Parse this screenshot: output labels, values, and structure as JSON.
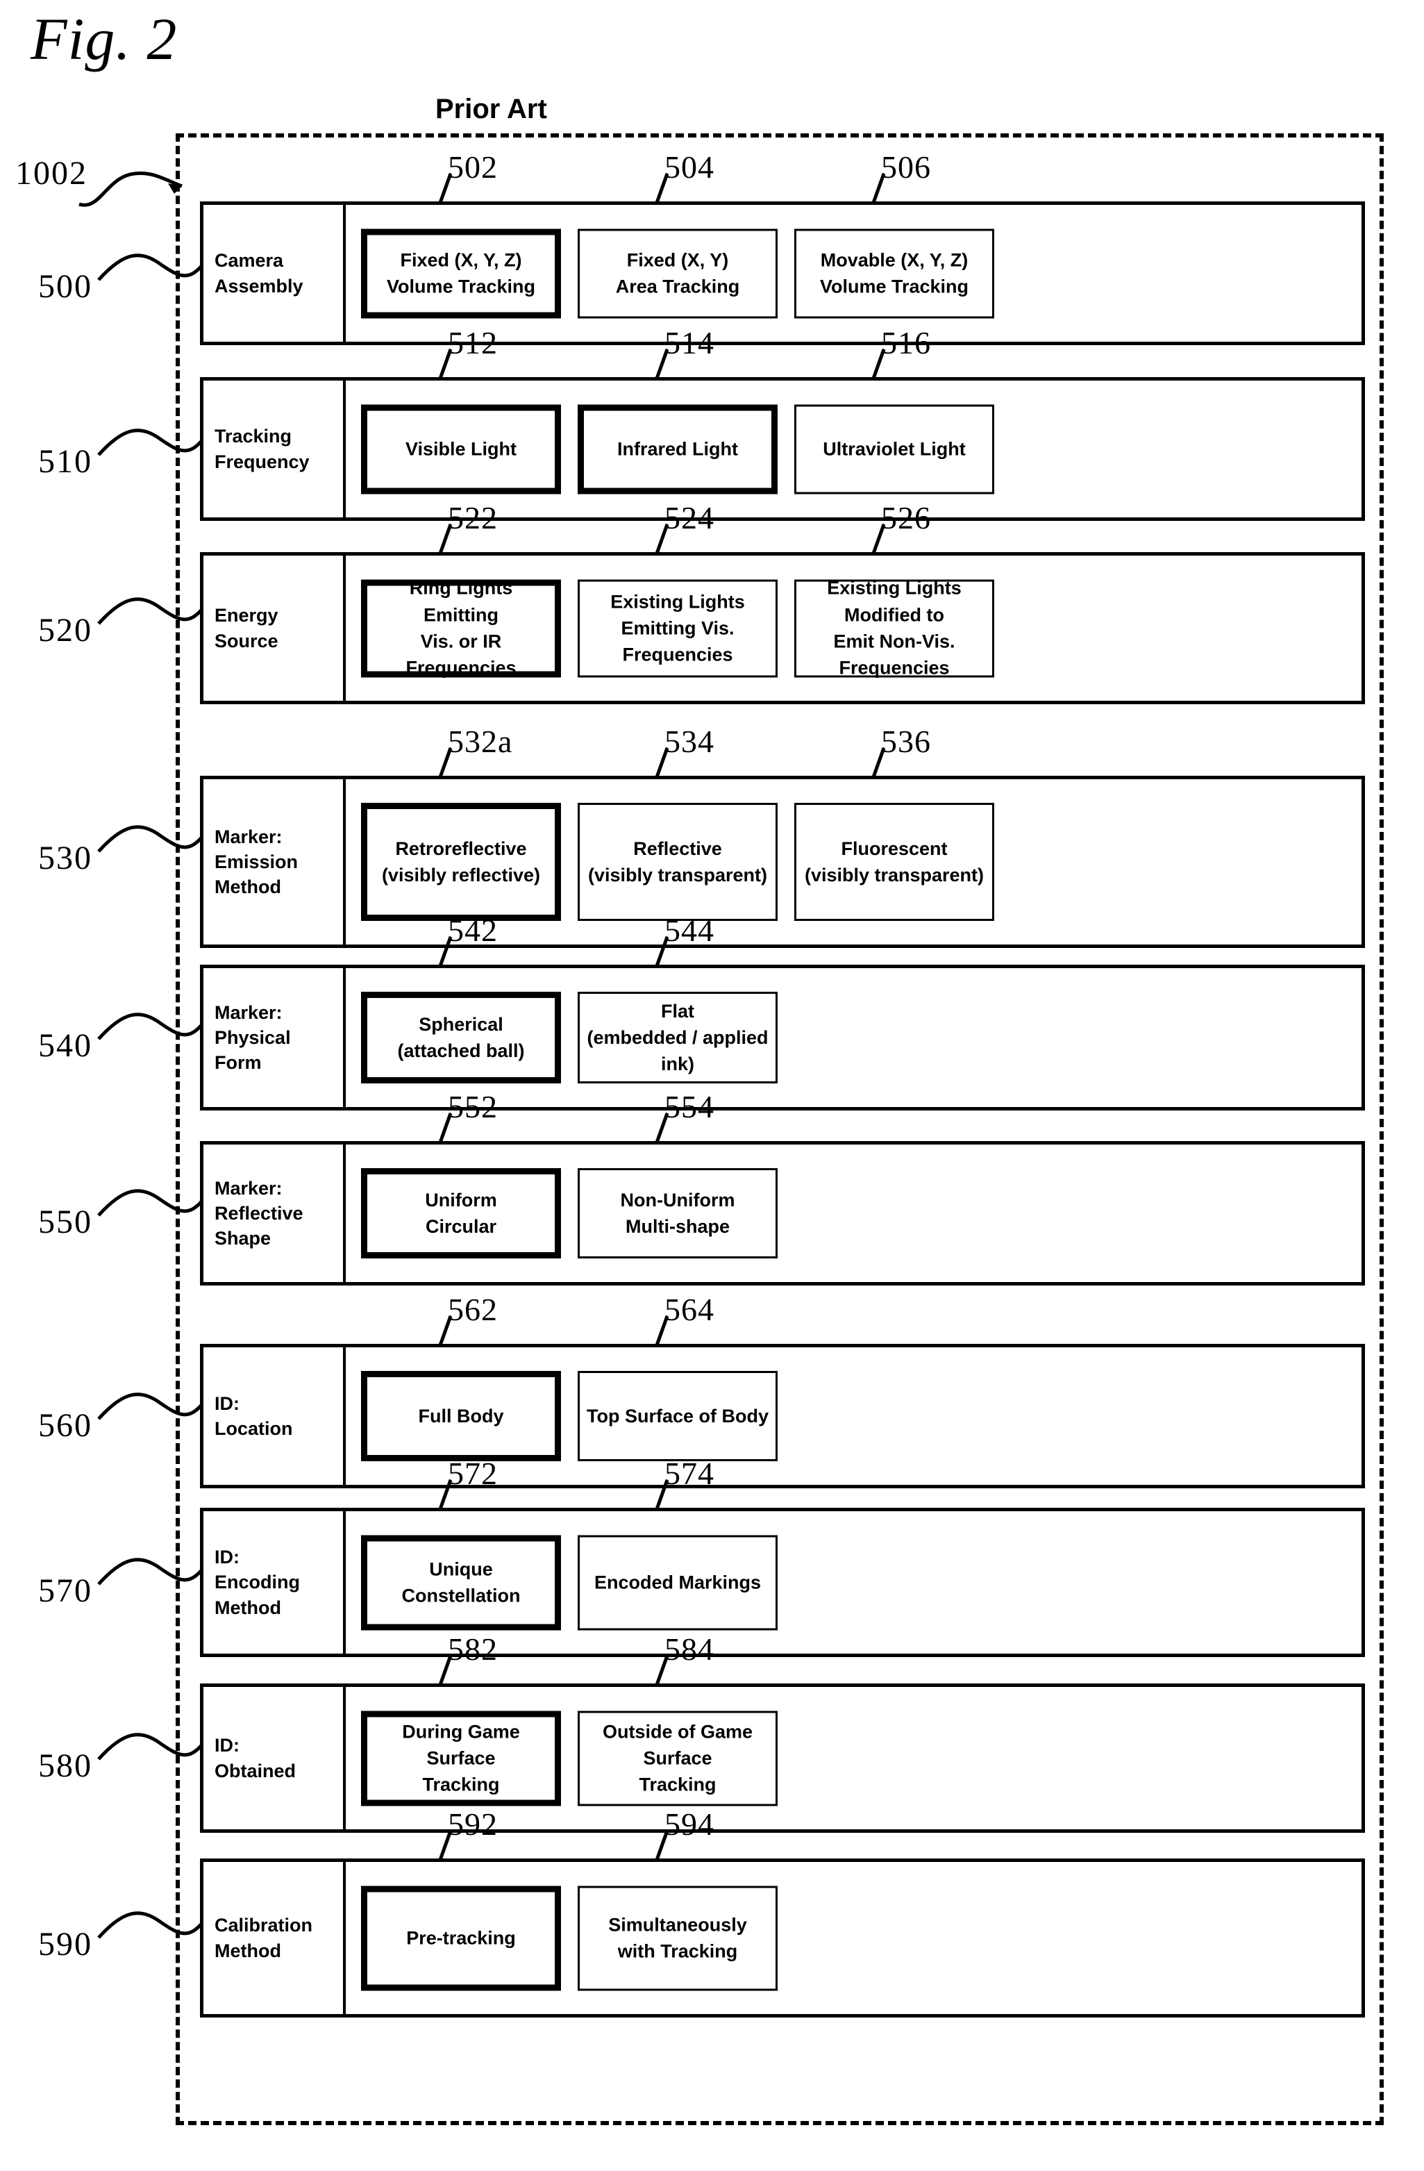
{
  "figure": {
    "label": "Fig. 2",
    "note": "Prior Art",
    "enclosure_ref": "1002"
  },
  "rows": [
    {
      "ref": "500",
      "label": "Camera\nAssembly",
      "cells": [
        {
          "ref": "502",
          "text": "Fixed (X, Y, Z)\nVolume Tracking",
          "highlighted": true
        },
        {
          "ref": "504",
          "text": "Fixed (X, Y)\nArea Tracking",
          "highlighted": false
        },
        {
          "ref": "506",
          "text": "Movable (X, Y, Z)\nVolume Tracking",
          "highlighted": false
        }
      ]
    },
    {
      "ref": "510",
      "label": "Tracking\nFrequency",
      "cells": [
        {
          "ref": "512",
          "text": "Visible Light",
          "highlighted": true
        },
        {
          "ref": "514",
          "text": "Infrared Light",
          "highlighted": true
        },
        {
          "ref": "516",
          "text": "Ultraviolet Light",
          "highlighted": false
        }
      ]
    },
    {
      "ref": "520",
      "label": "Energy\nSource",
      "cells": [
        {
          "ref": "522",
          "text": "Ring Lights Emitting\nVis. or IR Frequencies",
          "highlighted": true
        },
        {
          "ref": "524",
          "text": "Existing Lights\nEmitting Vis. Frequencies",
          "highlighted": false
        },
        {
          "ref": "526",
          "text": "Existing Lights Modified to\nEmit Non-Vis. Frequencies",
          "highlighted": false
        }
      ]
    },
    {
      "ref": "530",
      "label": "Marker:\nEmission\nMethod",
      "cells": [
        {
          "ref": "532a",
          "text": "Retroreflective\n(visibly reflective)",
          "highlighted": true
        },
        {
          "ref": "534",
          "text": "Reflective\n(visibly transparent)",
          "highlighted": false
        },
        {
          "ref": "536",
          "text": "Fluorescent\n(visibly transparent)",
          "highlighted": false
        }
      ]
    },
    {
      "ref": "540",
      "label": "Marker:\nPhysical\nForm",
      "cells": [
        {
          "ref": "542",
          "text": "Spherical\n(attached ball)",
          "highlighted": true
        },
        {
          "ref": "544",
          "text": "Flat\n(embedded / applied ink)",
          "highlighted": false
        }
      ]
    },
    {
      "ref": "550",
      "label": "Marker:\nReflective\nShape",
      "cells": [
        {
          "ref": "552",
          "text": "Uniform\nCircular",
          "highlighted": true
        },
        {
          "ref": "554",
          "text": "Non-Uniform\nMulti-shape",
          "highlighted": false
        }
      ]
    },
    {
      "ref": "560",
      "label": "ID:\nLocation",
      "cells": [
        {
          "ref": "562",
          "text": "Full Body",
          "highlighted": true
        },
        {
          "ref": "564",
          "text": "Top Surface of Body",
          "highlighted": false
        }
      ]
    },
    {
      "ref": "570",
      "label": "ID:\nEncoding\nMethod",
      "cells": [
        {
          "ref": "572",
          "text": "Unique Constellation",
          "highlighted": true
        },
        {
          "ref": "574",
          "text": "Encoded Markings",
          "highlighted": false
        }
      ]
    },
    {
      "ref": "580",
      "label": "ID:\nObtained",
      "cells": [
        {
          "ref": "582",
          "text": "During Game Surface\nTracking",
          "highlighted": true
        },
        {
          "ref": "584",
          "text": "Outside of Game Surface\nTracking",
          "highlighted": false
        }
      ]
    },
    {
      "ref": "590",
      "label": "Calibration\nMethod",
      "cells": [
        {
          "ref": "592",
          "text": "Pre-tracking",
          "highlighted": true
        },
        {
          "ref": "594",
          "text": "Simultaneously\nwith Tracking",
          "highlighted": false
        }
      ]
    }
  ],
  "colors": {
    "ink": "#000000",
    "paper": "#ffffff"
  }
}
